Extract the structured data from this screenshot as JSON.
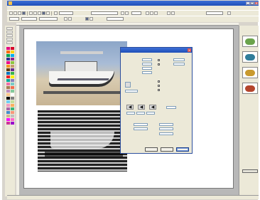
{
  "window": {
    "title": "",
    "min_label": "_",
    "max_label": "□",
    "close_label": "×"
  },
  "menubar": {
    "items": [
      "",
      "",
      "",
      "",
      "",
      "",
      "",
      ""
    ]
  },
  "toolbar1": {
    "font_field": "",
    "size_field": "",
    "zoom_field": ""
  },
  "toolbar2": {
    "field1": "",
    "field2": "",
    "field3": ""
  },
  "dialog": {
    "title": "",
    "close_label": "×",
    "labels": [
      "",
      "",
      "",
      "",
      "",
      "",
      "",
      "",
      ""
    ],
    "nav_prev": "◀",
    "nav_next": "◀",
    "nav_last": "◀",
    "ok_label": "",
    "cancel_label": "",
    "help_label": ""
  },
  "rightpanel": {
    "label": ""
  },
  "statusbar": {
    "text": ""
  },
  "colors": {
    "titlebar": "#1f4fb8",
    "chrome": "#ece9d8",
    "workspace": "#b8b8b8",
    "swatches_left": [
      "#e6007e",
      "#d80027",
      "#ff6a00",
      "#ffd400",
      "#00a651",
      "#00aeef",
      "#2e3192",
      "#92278f",
      "#ec008c",
      "#8dc63f",
      "#f7941d",
      "#c69c6d",
      "#603913",
      "#662d91",
      "#0072bc",
      "#39b54a",
      "#ed1c24",
      "#fff200",
      "#00a99d",
      "#8781bd",
      "#f06eaa",
      "#7accc8",
      "#a67c52",
      "#f26c4f",
      "#bd8cbf",
      "#82ca9c",
      "#fdc689",
      "#ffffff",
      "#000000",
      "#808080",
      "#6dcff6",
      "#c4df9b",
      "#f49ac1",
      "#fbaf5d",
      "#a864a8",
      "#3cb878",
      "#448ccb",
      "#f7977a",
      "#d2b48c",
      "#c0c0c0",
      "#ff00ff",
      "#ff66cc",
      "#cc3399",
      "#9900cc"
    ],
    "thumbs": [
      "#6aa34b",
      "#2f7d9a",
      "#c99a2e",
      "#b4452c"
    ]
  },
  "icons": {
    "app_icon": "app-icon",
    "close": "close-icon",
    "nav": "arrow-left-icon"
  }
}
